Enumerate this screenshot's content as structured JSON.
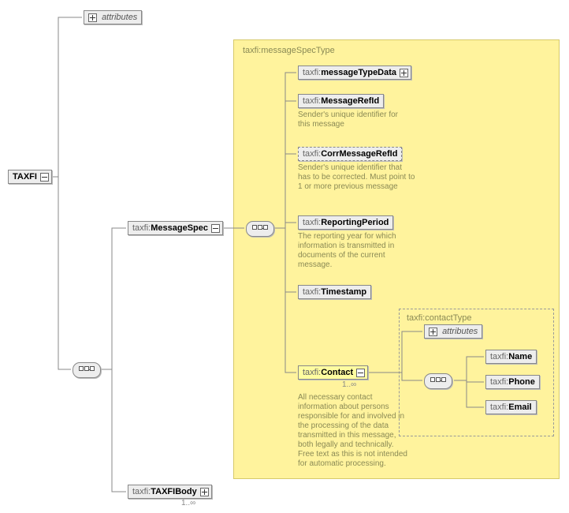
{
  "root": {
    "label": "TAXFI"
  },
  "attributes_label": "attributes",
  "message_spec_node": {
    "prefix": "taxfi:",
    "name": "MessageSpec"
  },
  "taxfi_body_node": {
    "prefix": "taxfi:",
    "name": "TAXFIBody",
    "card": "1..∞"
  },
  "spec_area_title": "taxfi:messageSpecType",
  "children": {
    "messageTypeData": {
      "prefix": "taxfi:",
      "name": "messageTypeData"
    },
    "MessageRefId": {
      "prefix": "taxfi:",
      "name": "MessageRefId",
      "desc": "Sender's unique identifier for this message"
    },
    "CorrMessageRefId": {
      "prefix": "taxfi:",
      "name": "CorrMessageRefId",
      "desc": "Sender's unique identifier that has to be corrected. Must point to 1 or more previous message"
    },
    "ReportingPeriod": {
      "prefix": "taxfi:",
      "name": "ReportingPeriod",
      "desc": "The reporting year for which information is transmitted in documents of the current message."
    },
    "Timestamp": {
      "prefix": "taxfi:",
      "name": "Timestamp"
    },
    "Contact": {
      "prefix": "taxfi:",
      "name": "Contact",
      "card": "1..∞",
      "desc": "All necessary contact information about persons responsible for and involved in the processing of the data transmitted in this message, both legally and technically. Free text as this is not intended for automatic processing."
    }
  },
  "contact_area_title": "taxfi:contactType",
  "contact_attributes_label": "attributes",
  "contact_children": {
    "Name": {
      "prefix": "taxfi:",
      "name": "Name"
    },
    "Phone": {
      "prefix": "taxfi:",
      "name": "Phone"
    },
    "Email": {
      "prefix": "taxfi:",
      "name": "Email"
    }
  }
}
